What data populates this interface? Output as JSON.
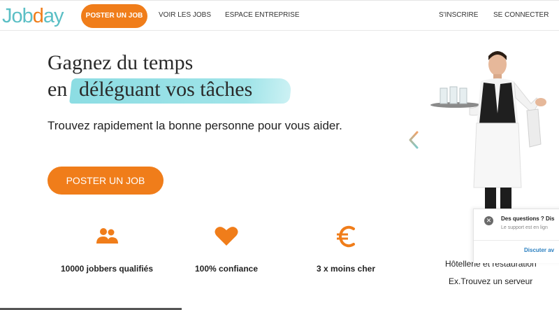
{
  "header": {
    "logo": {
      "part1": "Job",
      "part2": "d",
      "part3": "ay"
    },
    "cta_label": "POSTER UN JOB",
    "nav": [
      {
        "label": "VOIR LES JOBS"
      },
      {
        "label": "ESPACE ENTREPRISE"
      },
      {
        "label": "S'INSCRIRE"
      },
      {
        "label": "SE CONNECTER"
      }
    ]
  },
  "hero": {
    "title_line1": "Gagnez du temps",
    "title_prefix": "en",
    "title_highlight": "déléguant vos tâches",
    "subtitle": "Trouvez rapidement la bonne personne pour vous aider.",
    "cta_label": "POSTER UN JOB"
  },
  "features": [
    {
      "icon": "users-icon",
      "label": "10000 jobbers qualifiés"
    },
    {
      "icon": "heart-icon",
      "label": "100% confiance"
    },
    {
      "icon": "euro-icon",
      "label": "3 x moins cher"
    }
  ],
  "carousel": {
    "category": "Hôtellerie et restauration",
    "example": "Ex.Trouvez un serveur"
  },
  "chat": {
    "title": "Des questions ? Dis",
    "subtitle": "Le support est en lign",
    "link": "Discuter av"
  },
  "colors": {
    "accent": "#f07d1a",
    "teal": "#5bbfc5",
    "highlight": "#7dd8de"
  }
}
